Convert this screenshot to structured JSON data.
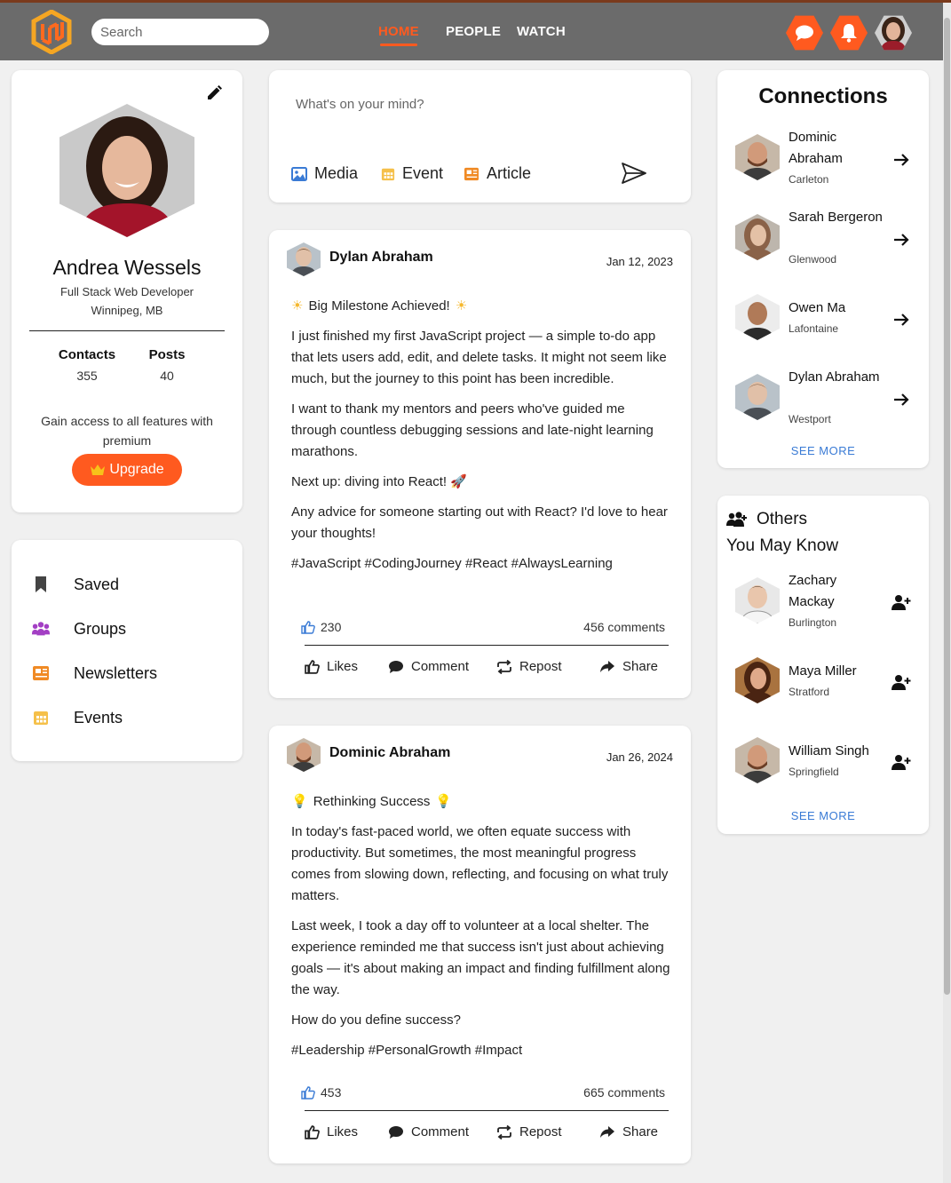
{
  "header": {
    "search_placeholder": "Search",
    "nav": [
      {
        "label": "HOME",
        "active": true
      },
      {
        "label": "PEOPLE",
        "active": false
      },
      {
        "label": "WATCH",
        "active": false
      }
    ],
    "accent_color": "#ff5a1f"
  },
  "profile": {
    "name": "Andrea Wessels",
    "title": "Full Stack Web Developer",
    "location": "Winnipeg, MB",
    "contacts_label": "Contacts",
    "contacts_value": "355",
    "posts_label": "Posts",
    "posts_value": "40",
    "premium_text": "Gain access to all features with premium",
    "upgrade_label": "Upgrade"
  },
  "menu": {
    "items": [
      {
        "label": "Saved",
        "icon": "bookmark-icon"
      },
      {
        "label": "Groups",
        "icon": "groups-icon"
      },
      {
        "label": "Newsletters",
        "icon": "newspaper-icon"
      },
      {
        "label": "Events",
        "icon": "calendar-icon"
      }
    ]
  },
  "composer": {
    "placeholder": "What's on your mind?",
    "media_label": "Media",
    "event_label": "Event",
    "article_label": "Article"
  },
  "posts": [
    {
      "author": "Dylan Abraham",
      "date": "Jan 12, 2023",
      "headline": "Big Milestone Achieved!",
      "paragraphs": [
        "I just finished my first JavaScript project — a simple to-do app that lets users add, edit, and delete tasks. It might not seem like much, but the journey to this point has been incredible.",
        "I want to thank my mentors and peers who've guided me through countless debugging sessions and late-night learning marathons.",
        "Next up: diving into React! 🚀",
        "Any advice for someone starting out with React? I'd love to hear your thoughts!",
        "#JavaScript #CodingJourney #React #AlwaysLearning"
      ],
      "likes": "230",
      "comments": "456 comments"
    },
    {
      "author": "Dominic Abraham",
      "date": "Jan 26, 2024",
      "headline": "Rethinking Success",
      "paragraphs": [
        "In today's fast-paced world, we often equate success with productivity. But sometimes, the most meaningful progress comes from slowing down, reflecting, and focusing on what truly matters.",
        "Last week, I took a day off to volunteer at a local shelter. The experience reminded me that success isn't just about achieving goals — it's about making an impact and finding fulfillment along the way.",
        "How do you define success?",
        "#Leadership #PersonalGrowth #Impact"
      ],
      "likes": "453",
      "comments": "665 comments"
    }
  ],
  "post_actions": {
    "likes": "Likes",
    "comment": "Comment",
    "repost": "Repost",
    "share": "Share"
  },
  "connections": {
    "title": "Connections",
    "people": [
      {
        "name": "Dominic Abraham",
        "city": "Carleton"
      },
      {
        "name": "Sarah Bergeron",
        "city": "Glenwood"
      },
      {
        "name": "Owen Ma",
        "city": "Lafontaine"
      },
      {
        "name": "Dylan Abraham",
        "city": "Westport"
      }
    ],
    "see_more": "SEE MORE"
  },
  "others": {
    "title_line1": "Others",
    "title_line2": "You May Know",
    "people": [
      {
        "name": "Zachary Mackay",
        "city": "Burlington"
      },
      {
        "name": "Maya Miller",
        "city": "Stratford"
      },
      {
        "name": "William Singh",
        "city": "Springfield"
      }
    ],
    "see_more": "SEE MORE"
  }
}
